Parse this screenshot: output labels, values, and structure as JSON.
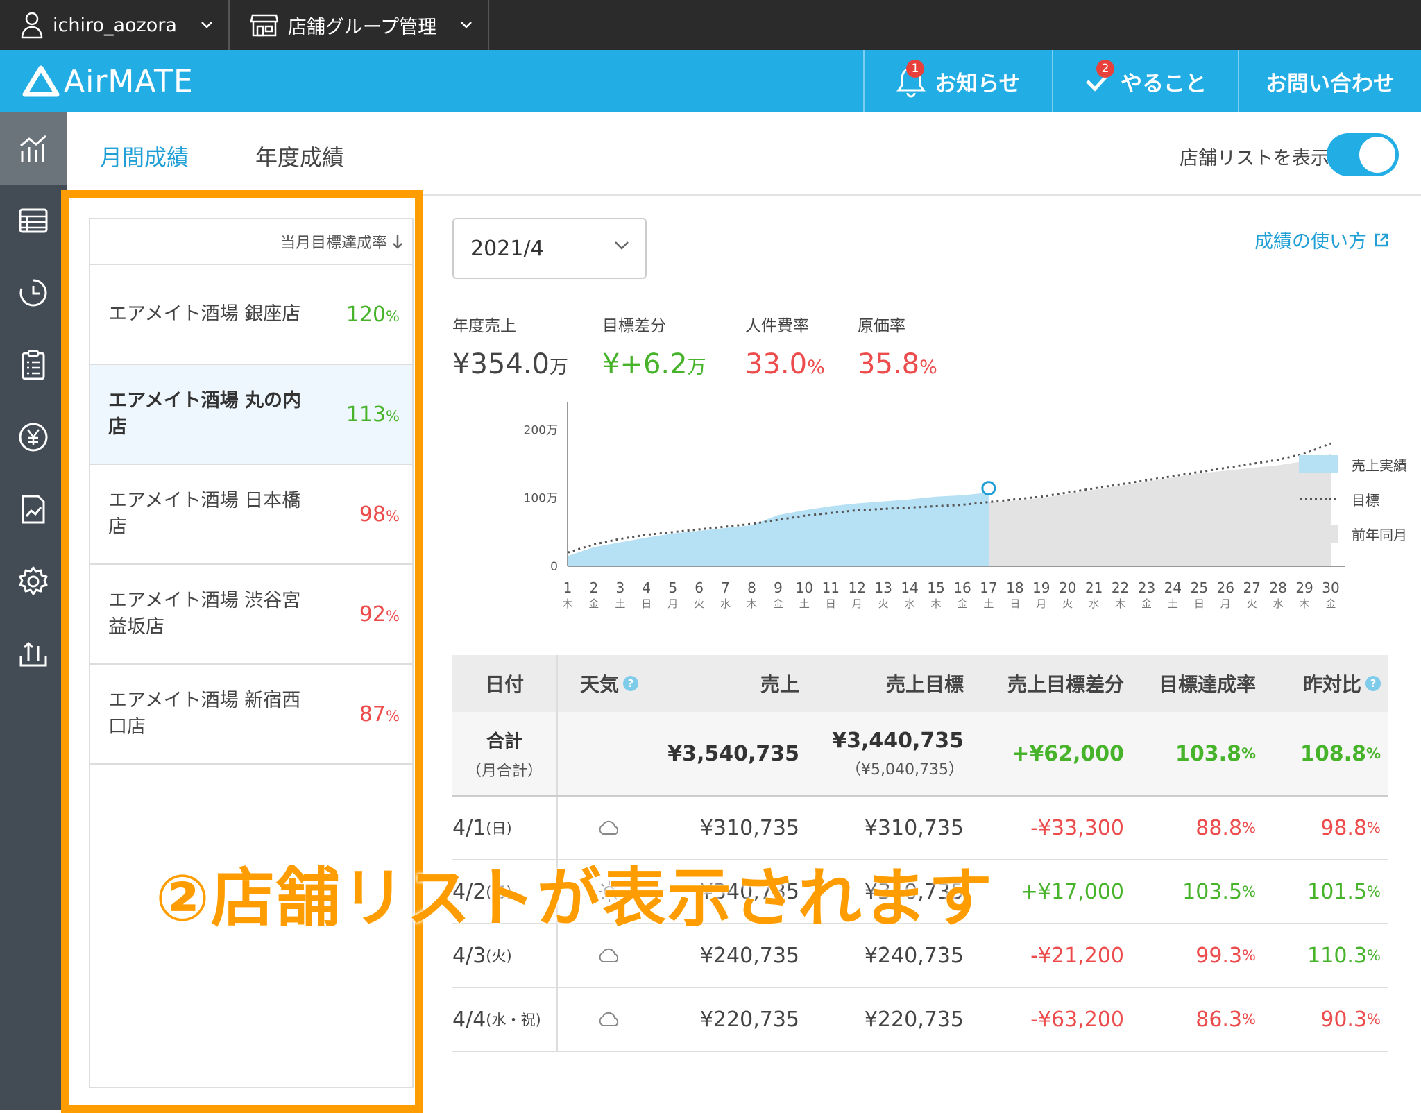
{
  "topbar": {
    "user": "ichiro_aozora",
    "group": "店舗グループ管理"
  },
  "header": {
    "logo": "AirMATE",
    "nav": [
      {
        "label": "お知らせ",
        "badge": "1"
      },
      {
        "label": "やること",
        "badge": "2"
      },
      {
        "label": "お問い合わせ"
      }
    ]
  },
  "sidebar": {
    "icons": [
      "chart-icon",
      "table-icon",
      "history-icon",
      "checklist-icon",
      "yen-icon",
      "report-icon",
      "settings-icon",
      "upload-icon"
    ]
  },
  "tabs": {
    "monthly": "月間成績",
    "yearly": "年度成績",
    "toggle_label": "店舗リストを表示",
    "toggle_on": true
  },
  "store_list": {
    "sort_label": "当月目標達成率",
    "stores": [
      {
        "name": "エアメイト酒場 銀座店",
        "pct": "120",
        "unit": "%",
        "status": "good"
      },
      {
        "name": "エアメイト酒場 丸の内店",
        "pct": "113",
        "unit": "%",
        "status": "good",
        "selected": true
      },
      {
        "name": "エアメイト酒場 日本橋店",
        "pct": "98",
        "unit": "%",
        "status": "bad"
      },
      {
        "name": "エアメイト酒場 渋谷宮益坂店",
        "pct": "92",
        "unit": "%",
        "status": "bad"
      },
      {
        "name": "エアメイト酒場 新宿西口店",
        "pct": "87",
        "unit": "%",
        "status": "bad"
      }
    ]
  },
  "month_select": "2021/4",
  "howto_link": "成績の使い方",
  "kpis": [
    {
      "label": "年度売上",
      "value": "¥354.0",
      "unit": "万",
      "color": "#444444"
    },
    {
      "label": "目標差分",
      "value": "¥+6.2",
      "unit": "万",
      "color": "#46b32a"
    },
    {
      "label": "人件費率",
      "value": "33.0",
      "unit": "%",
      "color": "#ec4c4c"
    },
    {
      "label": "原価率",
      "value": "35.8",
      "unit": "%",
      "color": "#ec4c4c"
    }
  ],
  "chart_data": {
    "type": "area",
    "x": [
      1,
      2,
      3,
      4,
      5,
      6,
      7,
      8,
      9,
      10,
      11,
      12,
      13,
      14,
      15,
      16,
      17,
      18,
      19,
      20,
      21,
      22,
      23,
      24,
      25,
      26,
      27,
      28,
      29,
      30
    ],
    "weekday": [
      "木",
      "金",
      "土",
      "日",
      "月",
      "火",
      "水",
      "木",
      "金",
      "土",
      "日",
      "月",
      "火",
      "水",
      "木",
      "金",
      "土",
      "日",
      "月",
      "火",
      "水",
      "木",
      "金",
      "土",
      "日",
      "月",
      "火",
      "水",
      "木",
      "金"
    ],
    "yticks": [
      "0",
      "100万",
      "200万"
    ],
    "ylim": [
      0,
      240
    ],
    "series": [
      {
        "name": "売上実績",
        "color": "#b6e1f5",
        "values": [
          15,
          28,
          35,
          42,
          48,
          52,
          56,
          60,
          75,
          82,
          88,
          92,
          95,
          98,
          102,
          104,
          108
        ]
      },
      {
        "name": "目標",
        "style": "dotted",
        "values": [
          20,
          32,
          40,
          46,
          50,
          54,
          58,
          62,
          68,
          74,
          78,
          82,
          84,
          86,
          88,
          90,
          94,
          98,
          102,
          108,
          114,
          120,
          126,
          132,
          138,
          144,
          150,
          156,
          165,
          180
        ]
      },
      {
        "name": "前年同月",
        "color": "#e3e3e3",
        "values": [
          12,
          22,
          30,
          36,
          40,
          45,
          48,
          52,
          66,
          74,
          80,
          84,
          86,
          88,
          90,
          92,
          94,
          96,
          100,
          106,
          112,
          118,
          124,
          130,
          136,
          140,
          144,
          148,
          154,
          164
        ]
      }
    ]
  },
  "table": {
    "headers": {
      "date": "日付",
      "weather": "天気",
      "sales": "売上",
      "target": "売上目標",
      "diff": "売上目標差分",
      "rate": "目標達成率",
      "yoy": "昨対比"
    },
    "total": {
      "label": "合計",
      "sub": "（月合計）",
      "sales": "¥3,540,735",
      "target": "¥3,440,735",
      "target_sub": "（¥5,040,735）",
      "diff": "+¥62,000",
      "rate": "103.8",
      "yoy": "108.8",
      "unit": "%"
    },
    "rows": [
      {
        "date": "4/1",
        "dow": "(日)",
        "weather": "cloud-icon",
        "sales": "¥310,735",
        "target": "¥310,735",
        "diff": "-¥33,300",
        "diff_color": "#ec4c4c",
        "rate": "88.8",
        "rate_color": "#ec4c4c",
        "yoy": "98.8",
        "yoy_color": "#ec4c4c"
      },
      {
        "date": "4/2",
        "dow": "(月)",
        "weather": "sun-icon",
        "sales": "¥340,735",
        "target": "¥340,735",
        "diff": "+¥17,000",
        "diff_color": "#46b32a",
        "rate": "103.5",
        "rate_color": "#46b32a",
        "yoy": "101.5",
        "yoy_color": "#46b32a"
      },
      {
        "date": "4/3",
        "dow": "(火)",
        "weather": "cloud-icon",
        "sales": "¥240,735",
        "target": "¥240,735",
        "diff": "-¥21,200",
        "diff_color": "#ec4c4c",
        "rate": "99.3",
        "rate_color": "#ec4c4c",
        "yoy": "110.3",
        "yoy_color": "#46b32a"
      },
      {
        "date": "4/4",
        "dow": "(水・祝)",
        "weather": "cloud-icon",
        "sales": "¥220,735",
        "target": "¥220,735",
        "diff": "-¥63,200",
        "diff_color": "#ec4c4c",
        "rate": "86.3",
        "rate_color": "#ec4c4c",
        "yoy": "90.3",
        "yoy_color": "#ec4c4c"
      }
    ]
  },
  "annotation": "②店舗リストが表示されます"
}
